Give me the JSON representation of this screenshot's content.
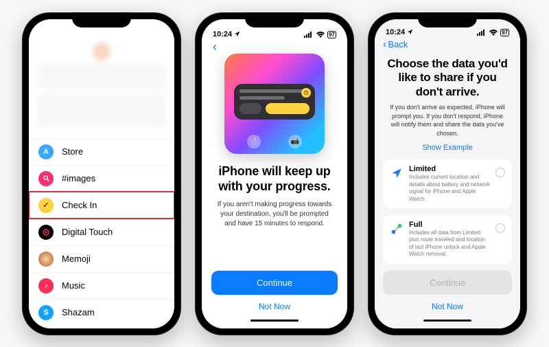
{
  "status": {
    "time": "10:24",
    "battery": "97"
  },
  "phone1": {
    "menu": [
      {
        "label": "Store"
      },
      {
        "label": "#images"
      },
      {
        "label": "Check In"
      },
      {
        "label": "Digital Touch"
      },
      {
        "label": "Memoji"
      },
      {
        "label": "Music"
      },
      {
        "label": "Shazam"
      }
    ]
  },
  "phone2": {
    "back": "Back",
    "title": "iPhone will keep up with your progress.",
    "subtitle": "If you aren't making progress towards your destination, you'll be prompted and have 15 minutes to respond.",
    "continue": "Continue",
    "notnow": "Not Now"
  },
  "phone3": {
    "back": "Back",
    "title": "Choose the data you'd like to share if you don't arrive.",
    "subtitle": "If you don't arrive as expected, iPhone will prompt you. If you don't respond, iPhone will notify them and share the data you've chosen.",
    "show_example": "Show Example",
    "options": [
      {
        "title": "Limited",
        "desc": "Includes current location and details about battery and network signal for iPhone and Apple Watch."
      },
      {
        "title": "Full",
        "desc": "Includes all data from Limited plus route traveled and location of last iPhone unlock and Apple Watch removal."
      }
    ],
    "continue": "Continue",
    "notnow": "Not Now"
  }
}
